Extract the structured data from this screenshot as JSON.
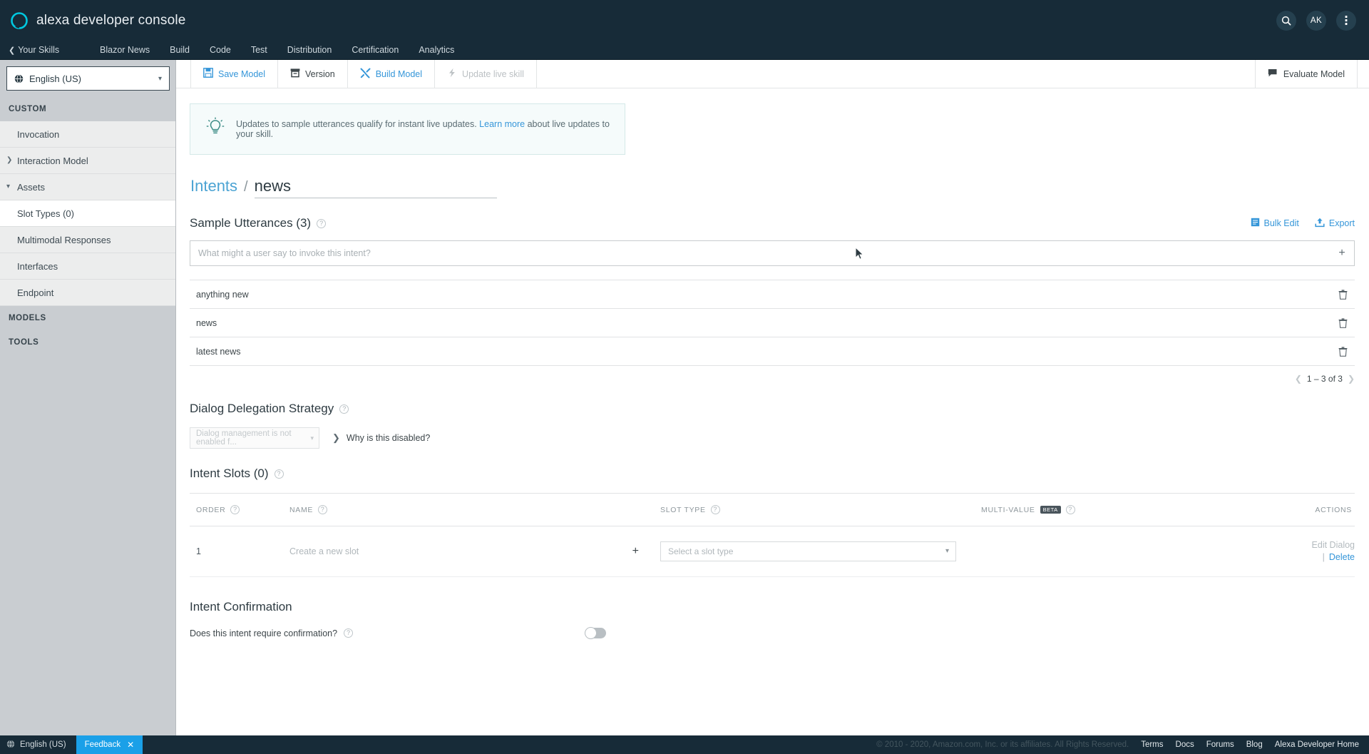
{
  "header": {
    "brand_title": "alexa developer console",
    "logo_icon": "alexa-ring-icon",
    "search_icon": "search-icon",
    "avatar_initials": "AK",
    "more_icon": "vertical-dots-icon"
  },
  "nav": {
    "back_label": "Your Skills",
    "back_icon": "chevron-left-icon",
    "items": [
      {
        "label": "Blazor News"
      },
      {
        "label": "Build"
      },
      {
        "label": "Code"
      },
      {
        "label": "Test"
      },
      {
        "label": "Distribution"
      },
      {
        "label": "Certification"
      },
      {
        "label": "Analytics"
      }
    ]
  },
  "sidebar": {
    "locale": {
      "value": "English (US)",
      "icon": "globe-icon",
      "caret": "chevron-down-icon"
    },
    "groups": [
      {
        "label": "CUSTOM",
        "items": [
          {
            "label": "Invocation",
            "arrow": "",
            "active": false
          },
          {
            "label": "Interaction Model",
            "arrow": "chevron-right-icon",
            "active": false
          },
          {
            "label": "Assets",
            "arrow": "chevron-down-icon",
            "active": false
          },
          {
            "label": "Slot Types (0)",
            "arrow": "",
            "active": true
          },
          {
            "label": "Multimodal Responses",
            "arrow": "",
            "active": false
          },
          {
            "label": "Interfaces",
            "arrow": "",
            "active": false
          },
          {
            "label": "Endpoint",
            "arrow": "",
            "active": false
          }
        ]
      },
      {
        "label": "MODELS",
        "items": []
      },
      {
        "label": "TOOLS",
        "items": []
      }
    ]
  },
  "toolbar": {
    "save_label": "Save Model",
    "save_icon": "floppy-disk-icon",
    "version_label": "Version",
    "version_icon": "archive-box-icon",
    "build_label": "Build Model",
    "build_icon": "tools-icon",
    "update_label": "Update live skill",
    "update_icon": "lightning-bolt-icon",
    "evaluate_label": "Evaluate Model",
    "evaluate_icon": "chat-bubble-icon"
  },
  "banner": {
    "icon": "lightbulb-icon",
    "text_before": "Updates to sample utterances qualify for instant live updates. ",
    "link_label": "Learn more",
    "text_after": " about live updates to your skill."
  },
  "breadcrumb": {
    "parent": "Intents",
    "separator": "/",
    "current": "news"
  },
  "utterances_section": {
    "title": "Sample Utterances (3)",
    "help_icon": "question-mark-icon",
    "bulk_edit_label": "Bulk Edit",
    "bulk_edit_icon": "bulk-edit-icon",
    "export_label": "Export",
    "export_icon": "upload-icon",
    "input_placeholder": "What might a user say to invoke this intent?",
    "input_value": "",
    "add_icon": "plus-icon",
    "delete_icon": "trash-icon",
    "rows": [
      {
        "text": "anything new"
      },
      {
        "text": "news"
      },
      {
        "text": "latest news"
      }
    ],
    "pager": {
      "prev_icon": "chevron-left-icon",
      "label": "1 – 3 of 3",
      "next_icon": "chevron-right-icon"
    }
  },
  "dialog_delegation": {
    "title": "Dialog Delegation Strategy",
    "help_icon": "question-mark-icon",
    "select_value": "Dialog management is not enabled f...",
    "select_caret": "chevron-down-icon",
    "why_label": "Why is this disabled?",
    "why_icon": "chevron-right-icon"
  },
  "intent_slots": {
    "title": "Intent Slots (0)",
    "help_icon": "question-mark-icon",
    "columns": [
      {
        "label": "ORDER",
        "help": true
      },
      {
        "label": "NAME",
        "help": true
      },
      {
        "label": "SLOT TYPE",
        "help": true
      },
      {
        "label": "MULTI-VALUE",
        "badge": "BETA",
        "help": true
      },
      {
        "label": "ACTIONS",
        "help": false
      }
    ],
    "rows": [
      {
        "order": "1",
        "name_placeholder": "Create a new slot",
        "name_value": "",
        "add_icon": "plus-icon",
        "slot_type_placeholder": "Select a slot type",
        "slot_type_caret": "chevron-down-icon",
        "action_disabled": "Edit Dialog",
        "action_pipe": "|",
        "action_link": "Delete"
      }
    ]
  },
  "intent_confirmation": {
    "title": "Intent Confirmation",
    "question": "Does this intent require confirmation?",
    "help_icon": "question-mark-icon",
    "toggle_state": "off"
  },
  "footer": {
    "locale_icon": "globe-icon",
    "locale_label": "English (US)",
    "feedback_label": "Feedback",
    "feedback_close_icon": "close-icon",
    "copyright": "© 2010 - 2020, Amazon.com, Inc. or its affiliates. All Rights Reserved.",
    "links": [
      {
        "label": "Terms"
      },
      {
        "label": "Docs"
      },
      {
        "label": "Forums"
      },
      {
        "label": "Blog"
      },
      {
        "label": "Alexa Developer Home"
      }
    ]
  },
  "colors": {
    "header_bg": "#172b38",
    "accent_blue": "#3596d9",
    "sidebar_bg": "#c9cdd1",
    "banner_bg": "#f5fbfb",
    "feedback_blue": "#1aa0e8"
  }
}
